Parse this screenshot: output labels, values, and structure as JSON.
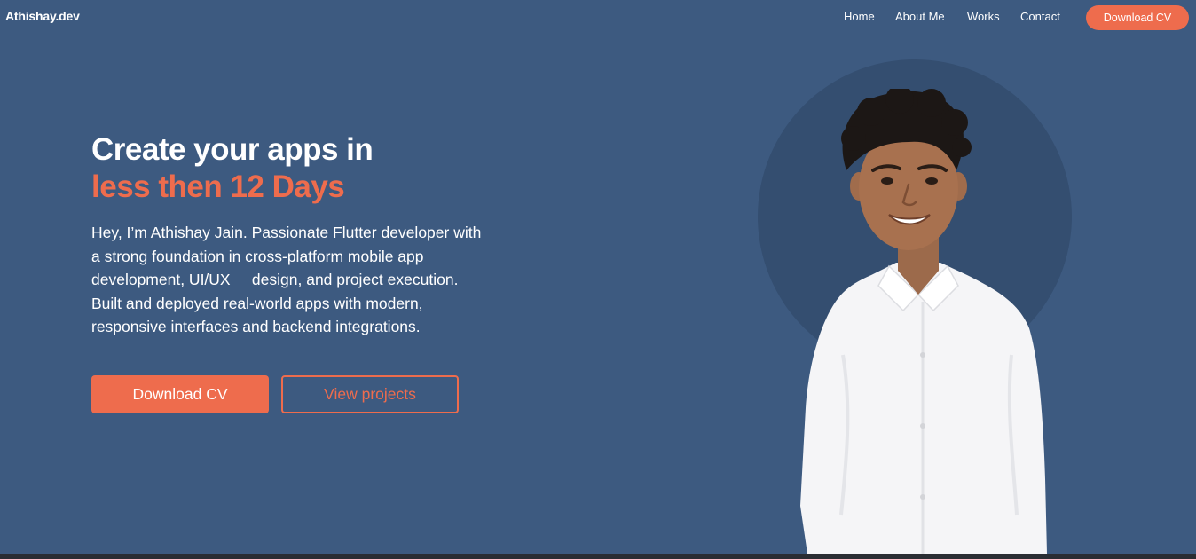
{
  "nav": {
    "logo": "Athishay.dev",
    "links": [
      "Home",
      "About Me",
      "Works",
      "Contact"
    ],
    "cta": "Download CV"
  },
  "hero": {
    "headline_line1": "Create your apps in",
    "headline_line2": "less then 12 Days",
    "intro": "Hey, I’m Athishay Jain. Passionate Flutter developer with a strong foundation in cross-platform mobile app development, UI/UX     design, and project execution. Built and deployed real-world apps with modern, responsive interfaces and backend integrations.",
    "primary_button": "Download CV",
    "secondary_button": "View projects"
  },
  "colors": {
    "background": "#3d5a80",
    "accent": "#ee6c4d",
    "circle": "#344e70",
    "text": "#ffffff"
  },
  "icons": {
    "portrait": "person-portrait-photo"
  }
}
